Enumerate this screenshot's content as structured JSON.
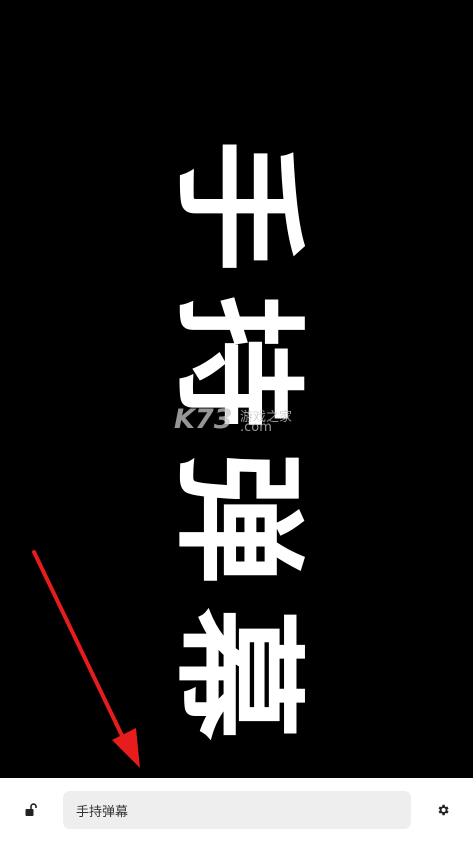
{
  "danmaku": {
    "text": "手持弹幕",
    "text_color": "#ffffff",
    "background_color": "#000000"
  },
  "watermark": {
    "brand": "K73",
    "tagline": "游戏之家",
    "domain": ".com"
  },
  "annotation": {
    "arrow_color": "#e81c1c"
  },
  "bottom_bar": {
    "lock_icon": "lock-open-icon",
    "input_value": "手持弹幕",
    "settings_icon": "gear-icon"
  }
}
